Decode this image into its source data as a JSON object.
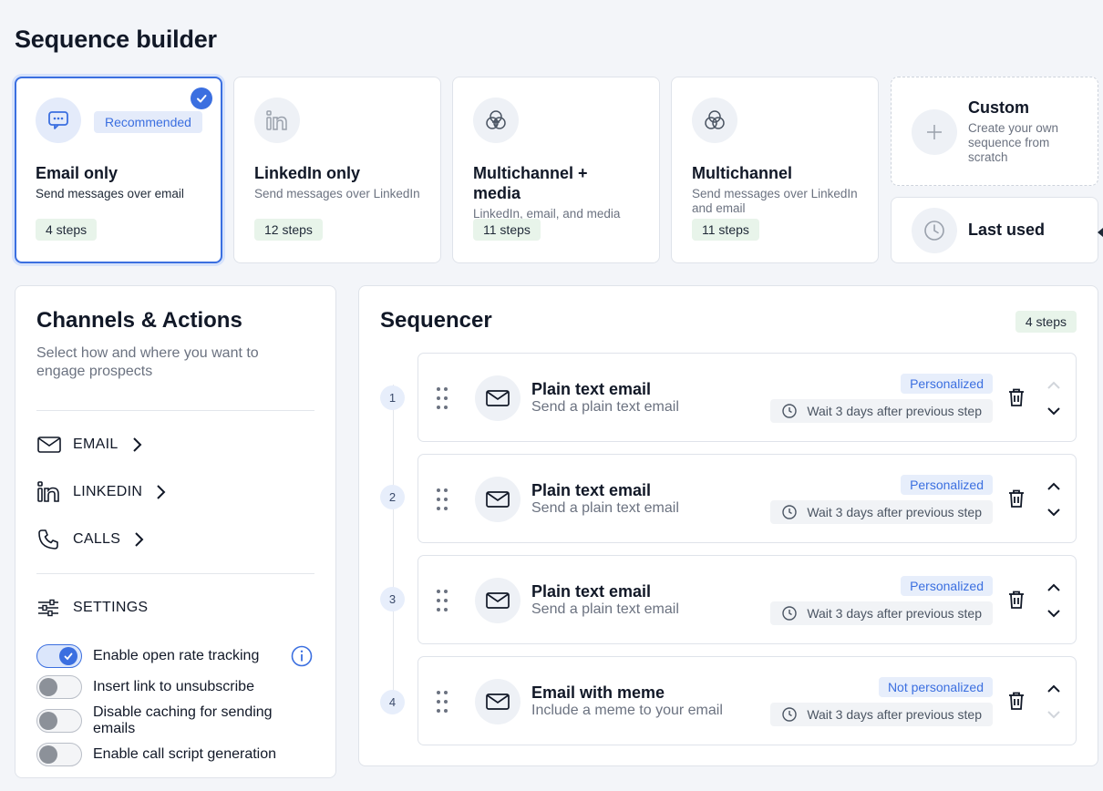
{
  "page": {
    "title": "Sequence builder"
  },
  "templates": [
    {
      "badge": "Recommended",
      "name": "Email only",
      "desc": "Send messages over email",
      "steps": "4 steps"
    },
    {
      "name": "LinkedIn only",
      "desc": "Send messages over LinkedIn",
      "steps": "12 steps"
    },
    {
      "name": "Multichannel + media",
      "desc": "LinkedIn, email, and media",
      "steps": "11 steps"
    },
    {
      "name": "Multichannel",
      "desc": "Send messages over LinkedIn and email",
      "steps": "11 steps"
    }
  ],
  "custom": {
    "title": "Custom",
    "desc": "Create your own sequence from scratch"
  },
  "last_used": {
    "label": "Last used"
  },
  "channels": {
    "title": "Channels & Actions",
    "subtitle": "Select how and where you want to engage prospects",
    "items": [
      {
        "label": "EMAIL",
        "icon": "mail-icon"
      },
      {
        "label": "LINKEDIN",
        "icon": "linkedin-icon"
      },
      {
        "label": "CALLS",
        "icon": "phone-icon"
      }
    ],
    "settings_label": "SETTINGS",
    "toggles": [
      {
        "label": "Enable open rate tracking",
        "on": true
      },
      {
        "label": "Insert link to unsubscribe",
        "on": false
      },
      {
        "label": "Disable caching for sending emails",
        "on": false
      },
      {
        "label": "Enable call script generation",
        "on": false
      }
    ]
  },
  "sequencer": {
    "title": "Sequencer",
    "count": "4 steps",
    "steps": [
      {
        "num": "1",
        "title": "Plain text email",
        "sub": "Send a plain text email",
        "badge": "Personalized",
        "wait": "Wait 3 days after previous step"
      },
      {
        "num": "2",
        "title": "Plain text email",
        "sub": "Send a plain text email",
        "badge": "Personalized",
        "wait": "Wait 3 days after previous step"
      },
      {
        "num": "3",
        "title": "Plain text email",
        "sub": "Send a plain text email",
        "badge": "Personalized",
        "wait": "Wait 3 days after previous step"
      },
      {
        "num": "4",
        "title": "Email with meme",
        "sub": "Include a meme to your email",
        "badge": "Not personalized",
        "wait": "Wait 3 days after previous step"
      }
    ]
  },
  "colors": {
    "accent": "#3b6fe0",
    "steps_bg": "#e8f4ea",
    "badge_bg": "#e7eefb"
  }
}
